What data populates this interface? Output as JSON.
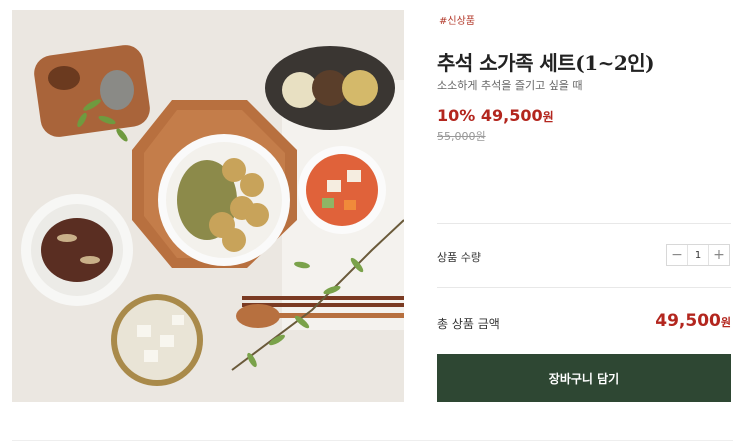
{
  "product": {
    "tag": "#신상품",
    "title": "추석 소가족 세트(1~2인)",
    "subtitle": "소소하게 추석을 즐기고 싶을 때",
    "discount": "10%",
    "price": "49,500",
    "price_unit": "원",
    "original_price": "55,000원"
  },
  "quantity": {
    "label": "상품 수량",
    "value": "1",
    "minus": "−",
    "plus": "+"
  },
  "total": {
    "label": "총 상품 금액",
    "value": "49,500",
    "unit": "원"
  },
  "cart_button": {
    "label": "장바구니 담기"
  },
  "colors": {
    "accent": "#b3261e",
    "button_bg": "#2e4733"
  },
  "image": {
    "alt": "추석 소가족 세트 상차림"
  }
}
